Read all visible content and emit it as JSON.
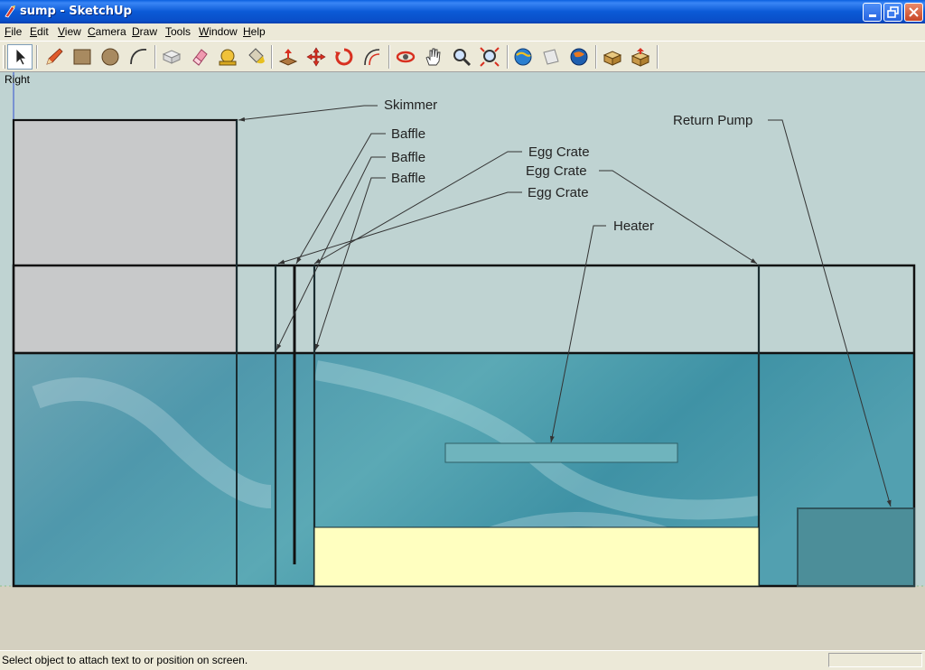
{
  "window": {
    "title": "sump - SketchUp"
  },
  "menu": {
    "items": [
      "File",
      "Edit",
      "View",
      "Camera",
      "Draw",
      "Tools",
      "Window",
      "Help"
    ]
  },
  "toolbar": {
    "tools": [
      {
        "name": "select-tool",
        "icon": "arrow-cursor-icon",
        "active": true
      },
      {
        "name": "pencil-tool",
        "icon": "pencil-icon"
      },
      {
        "name": "rectangle-tool",
        "icon": "rectangle-icon"
      },
      {
        "name": "circle-tool",
        "icon": "circle-icon"
      },
      {
        "name": "arc-tool",
        "icon": "arc-icon"
      },
      {
        "name": "make-component-tool",
        "icon": "component-icon"
      },
      {
        "name": "eraser-tool",
        "icon": "eraser-icon"
      },
      {
        "name": "tape-measure-tool",
        "icon": "tape-measure-icon"
      },
      {
        "name": "paint-bucket-tool",
        "icon": "paint-bucket-icon"
      },
      {
        "name": "push-pull-tool",
        "icon": "push-pull-icon"
      },
      {
        "name": "move-tool",
        "icon": "move-icon"
      },
      {
        "name": "rotate-tool",
        "icon": "rotate-icon"
      },
      {
        "name": "offset-tool",
        "icon": "offset-icon"
      },
      {
        "name": "orbit-tool",
        "icon": "orbit-icon"
      },
      {
        "name": "pan-tool",
        "icon": "hand-icon"
      },
      {
        "name": "zoom-tool",
        "icon": "magnifier-icon"
      },
      {
        "name": "zoom-extents-tool",
        "icon": "zoom-extents-icon"
      },
      {
        "name": "get-models-tool",
        "icon": "globe-download-icon"
      },
      {
        "name": "share-model-tool",
        "icon": "share-icon"
      },
      {
        "name": "google-earth-tool",
        "icon": "earth-icon"
      },
      {
        "name": "get-components-tool",
        "icon": "box-download-icon"
      },
      {
        "name": "share-component-tool",
        "icon": "box-share-icon"
      }
    ]
  },
  "viewport": {
    "view_name": "Right",
    "callouts": {
      "skimmer": "Skimmer",
      "baffle_1": "Baffle",
      "baffle_2": "Baffle",
      "baffle_3": "Baffle",
      "egg_crate_1": "Egg Crate",
      "egg_crate_2": "Egg Crate",
      "egg_crate_3": "Egg Crate",
      "heater": "Heater",
      "return_pump": "Return Pump"
    },
    "colors": {
      "background": "#bfd3d2",
      "ground": "#d4d0c0",
      "water": "#4a9aab",
      "skimmer_box": "#c8c9ca",
      "sand": "#ffffc0",
      "heater": "#6fb4bd",
      "pump": "#4b8b96"
    }
  },
  "status": {
    "message": "Select object to attach text to or position on screen."
  }
}
